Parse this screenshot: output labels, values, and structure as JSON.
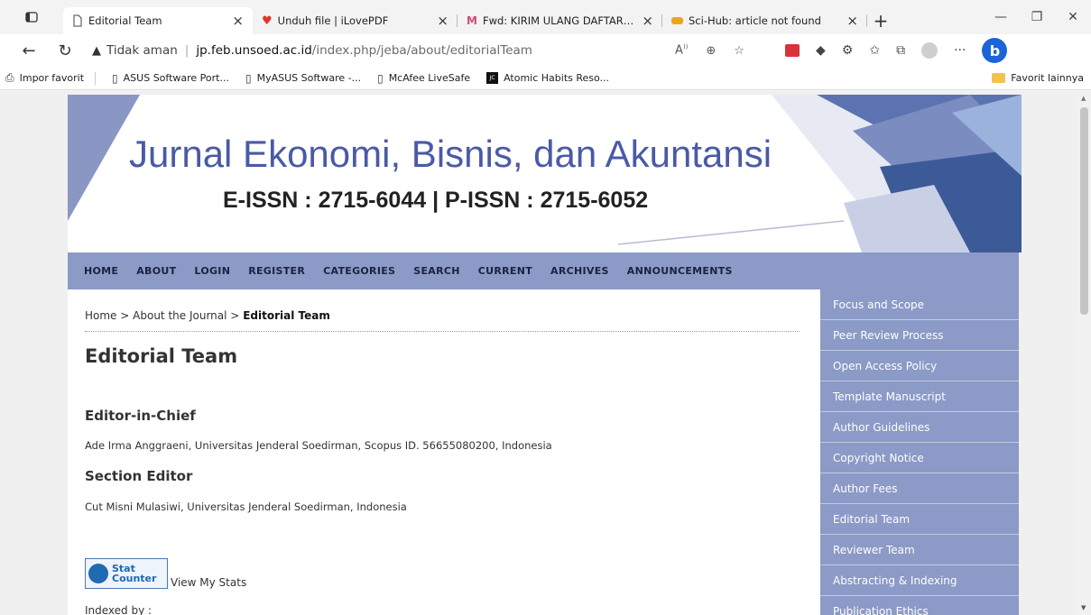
{
  "browser": {
    "tabs": [
      {
        "title": "Editorial Team",
        "active": true,
        "icon": "page-icon"
      },
      {
        "title": "Unduh file | iLovePDF",
        "active": false,
        "icon": "heart-icon"
      },
      {
        "title": "Fwd: KIRIM ULANG DAFTAR HAS",
        "active": false,
        "icon": "gmail-icon"
      },
      {
        "title": "Sci-Hub: article not found",
        "active": false,
        "icon": "scihub-icon"
      }
    ],
    "address": {
      "security_label": "Tidak aman",
      "host": "jp.feb.unsoed.ac.id",
      "path": "/index.php/jeba/about/editorialTeam"
    },
    "favorites": [
      {
        "label": "Impor favorit",
        "icon": "import-icon"
      },
      {
        "label": "ASUS Software Port...",
        "icon": "page-icon"
      },
      {
        "label": "MyASUS Software -...",
        "icon": "page-icon"
      },
      {
        "label": "McAfee LiveSafe",
        "icon": "page-icon"
      },
      {
        "label": "Atomic Habits Reso...",
        "icon": "jc-icon",
        "icon_text": "JC"
      }
    ],
    "favorites_other": "Favorit lainnya",
    "colors": {
      "bing": "#1b65d8",
      "folder": "#f3c24a"
    }
  },
  "site": {
    "banner_title": "Jurnal Ekonomi, Bisnis, dan Akuntansi",
    "banner_issn": "E-ISSN : 2715-6044 | P-ISSN : 2715-6052",
    "nav": [
      "HOME",
      "ABOUT",
      "LOGIN",
      "REGISTER",
      "CATEGORIES",
      "SEARCH",
      "CURRENT",
      "ARCHIVES",
      "ANNOUNCEMENTS"
    ],
    "breadcrumb": {
      "home": "Home",
      "sep": ">",
      "about": "About the Journal",
      "current": "Editorial Team"
    },
    "page_title": "Editorial Team",
    "editor_in_chief": {
      "heading": "Editor-in-Chief",
      "text": "Ade Irma Anggraeni, Universitas Jenderal Soedirman, Scopus ID. 56655080200, Indonesia"
    },
    "section_editor": {
      "heading": "Section Editor",
      "text": "Cut Misni Mulasiwi, Universitas Jenderal Soedirman, Indonesia"
    },
    "statcounter": {
      "line1": "Stat",
      "line2": "Counter",
      "link": "View My Stats"
    },
    "indexed_by": "Indexed by :",
    "sidebar": [
      "Focus and Scope",
      "Peer Review Process",
      "Open Access Policy",
      "Template Manuscript",
      "Author Guidelines",
      "Copyright Notice",
      "Author Fees",
      "Editorial Team",
      "Reviewer Team",
      "Abstracting & Indexing",
      "Publication Ethics"
    ],
    "colors": {
      "nav_bg": "#8b9ac6",
      "title": "#4a5aa5"
    }
  }
}
